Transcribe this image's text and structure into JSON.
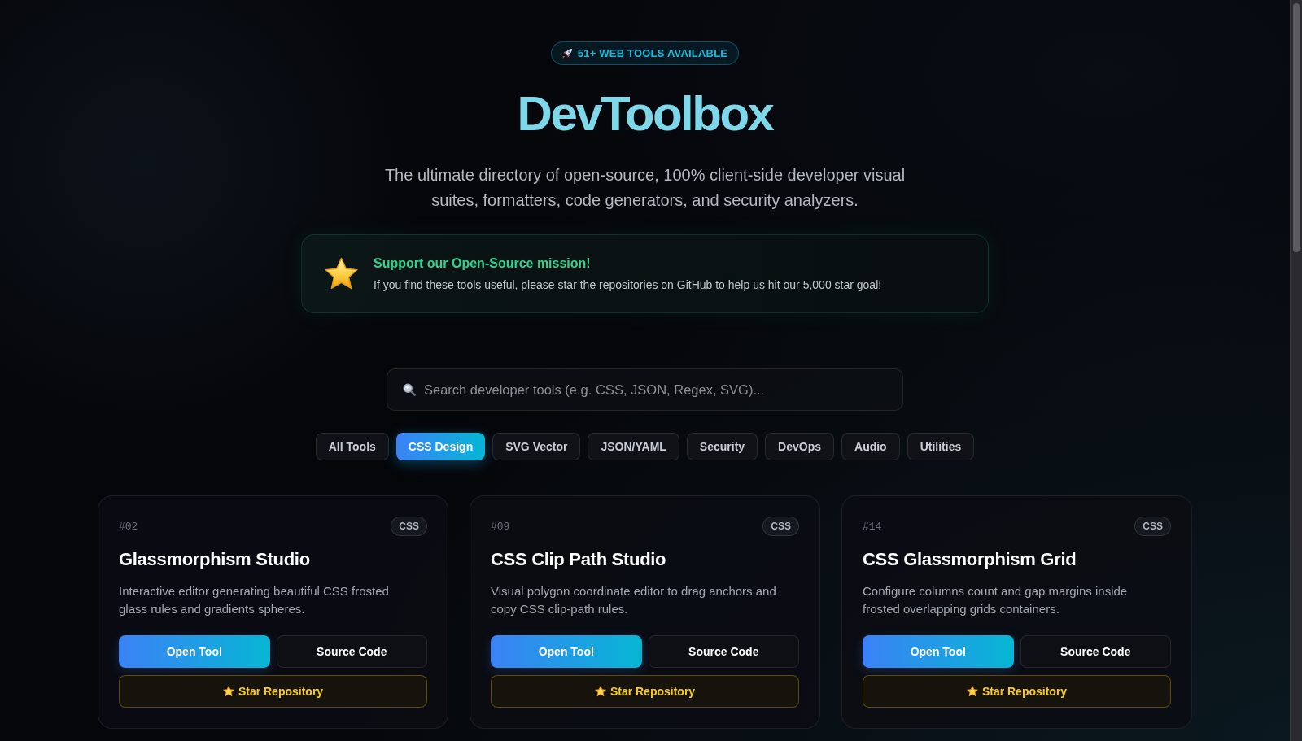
{
  "badge": {
    "text": "51+ WEB TOOLS AVAILABLE"
  },
  "title": "DevToolbox",
  "subtitle": "The ultimate directory of open-source, 100% client-side developer visual suites, formatters, code generators, and security analyzers.",
  "support": {
    "title": "Support our Open-Source mission!",
    "text": "If you find these tools useful, please star the repositories on GitHub to help us hit our 5,000 star goal!"
  },
  "search": {
    "placeholder": "Search developer tools (e.g. CSS, JSON, Regex, SVG)..."
  },
  "filters": [
    {
      "label": "All Tools",
      "selected": false
    },
    {
      "label": "CSS Design",
      "selected": true
    },
    {
      "label": "SVG Vector",
      "selected": false
    },
    {
      "label": "JSON/YAML",
      "selected": false
    },
    {
      "label": "Security",
      "selected": false
    },
    {
      "label": "DevOps",
      "selected": false
    },
    {
      "label": "Audio",
      "selected": false
    },
    {
      "label": "Utilities",
      "selected": false
    }
  ],
  "tools": [
    {
      "number": "#02",
      "tag": "CSS",
      "title": "Glassmorphism Studio",
      "description": "Interactive editor generating beautiful CSS frosted glass rules and gradients spheres.",
      "actions": [
        {
          "kind": "primary",
          "label": "Open Tool"
        },
        {
          "kind": "secondary",
          "label": "Source Code"
        },
        {
          "kind": "star",
          "label": "Star Repository"
        }
      ]
    },
    {
      "number": "#09",
      "tag": "CSS",
      "title": "CSS Clip Path Studio",
      "description": "Visual polygon coordinate editor to drag anchors and copy CSS clip-path rules.",
      "actions": [
        {
          "kind": "primary",
          "label": "Open Tool"
        },
        {
          "kind": "secondary",
          "label": "Source Code"
        },
        {
          "kind": "star",
          "label": "Star Repository"
        }
      ]
    },
    {
      "number": "#14",
      "tag": "CSS",
      "title": "CSS Glassmorphism Grid",
      "description": "Configure columns count and gap margins inside frosted overlapping grids containers.",
      "actions": [
        {
          "kind": "primary",
          "label": "Open Tool"
        },
        {
          "kind": "secondary",
          "label": "Source Code"
        },
        {
          "kind": "star",
          "label": "Star Repository"
        }
      ]
    }
  ]
}
